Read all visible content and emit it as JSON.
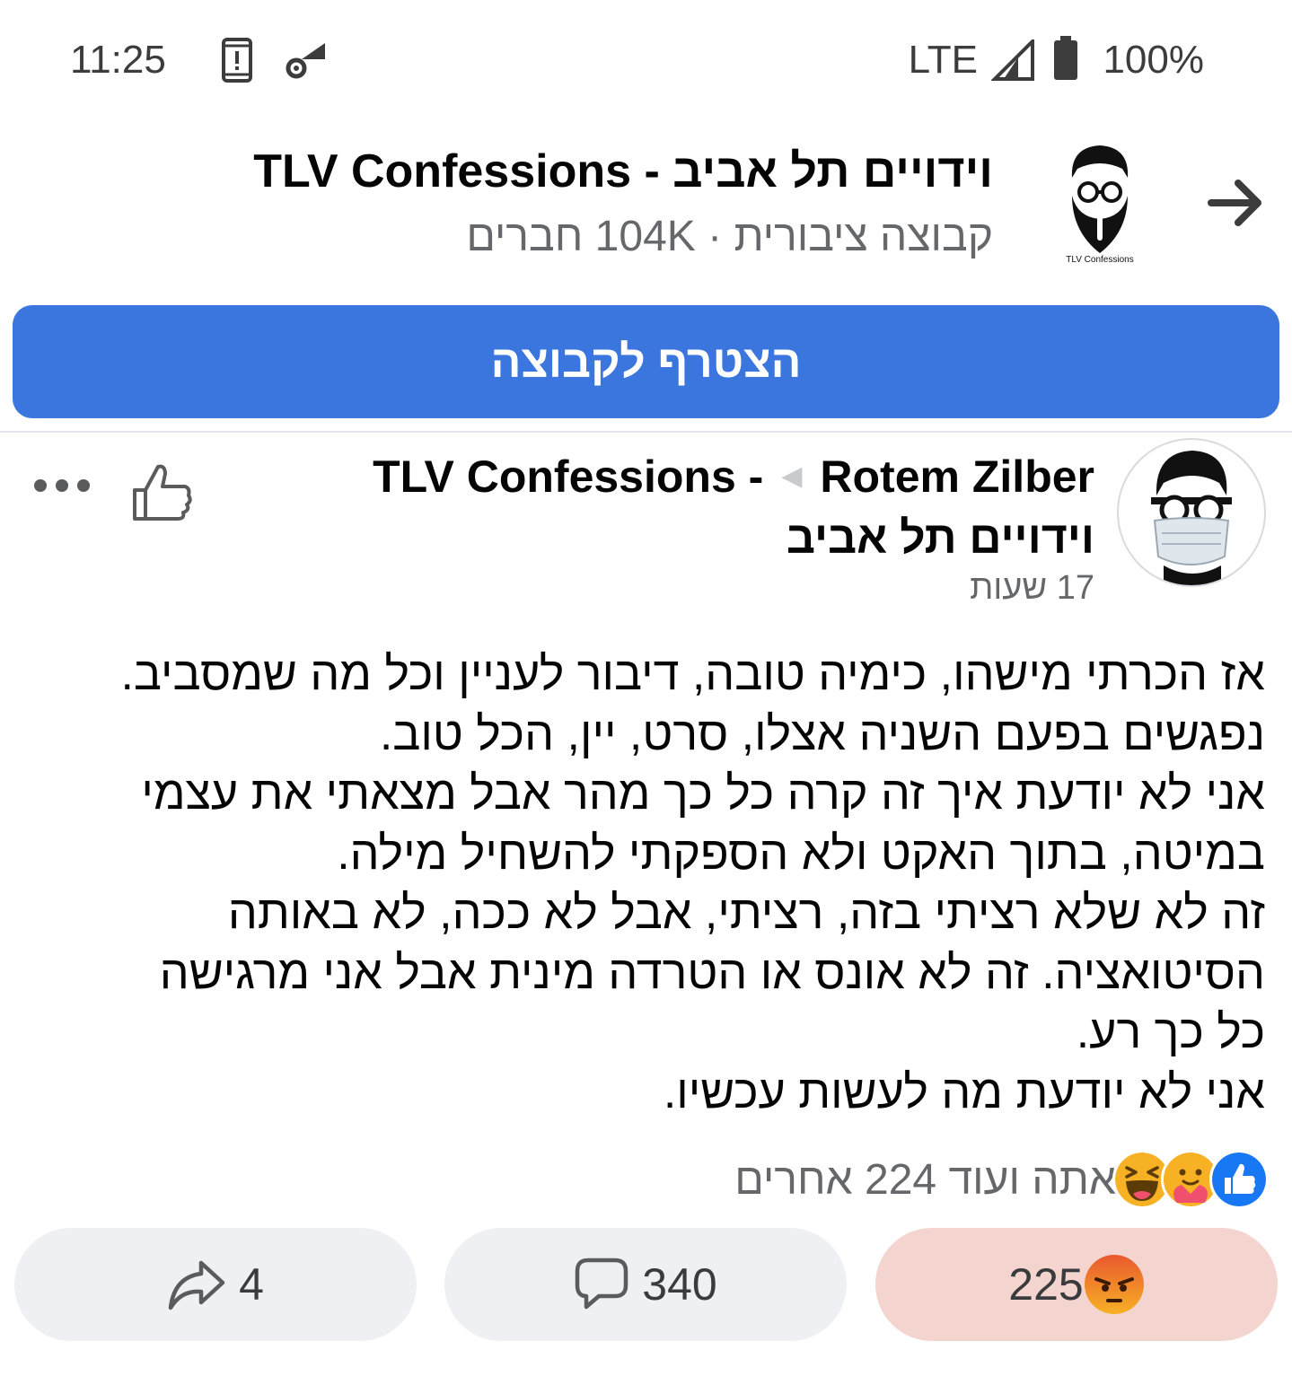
{
  "status_bar": {
    "time": "11:25",
    "network": "LTE",
    "battery": "100%",
    "icons": [
      "phone-alert-icon",
      "wifi-settings-icon",
      "signal-icon",
      "battery-icon"
    ]
  },
  "group": {
    "title": "וידויים תל אביב - TLV Confessions",
    "subtitle": "קבוצה ציבורית · 104K חברים",
    "logo_caption": "TLV Confessions"
  },
  "join_button": {
    "label": "הצטרף לקבוצה"
  },
  "post": {
    "author": "Rotem Zilber",
    "group_name_part1": "TLV Confessions -",
    "group_name_part2": "וידויים תל אביב",
    "time": "17 שעות",
    "lines": [
      "אז הכרתי מישהו, כימיה טובה, דיבור לעניין וכל מה שמסביב.",
      "נפגשים בפעם השניה אצלו, סרט, יין, הכל טוב.",
      "אני לא יודעת איך זה קרה כל כך מהר אבל מצאתי את עצמי",
      "במיטה, בתוך האקט ולא הספקתי להשחיל מילה.",
      "זה לא שלא רציתי בזה, רציתי, אבל לא ככה, לא באותה",
      "הסיטואציה. זה לא אונס או הטרדה מינית אבל אני מרגישה",
      "כל כך רע.",
      "אני לא יודעת מה לעשות עכשיו."
    ]
  },
  "reactions": {
    "summary": "אתה ועוד 224 אחרים",
    "types": [
      "like-reaction-icon",
      "care-reaction-icon",
      "haha-reaction-icon"
    ]
  },
  "actions": {
    "share_count": "4",
    "comment_count": "340",
    "reaction_count": "225"
  },
  "colors": {
    "brand_blue": "#3b75de",
    "angry_button_bg": "#f4d4cf",
    "secondary_text": "#65676b"
  }
}
